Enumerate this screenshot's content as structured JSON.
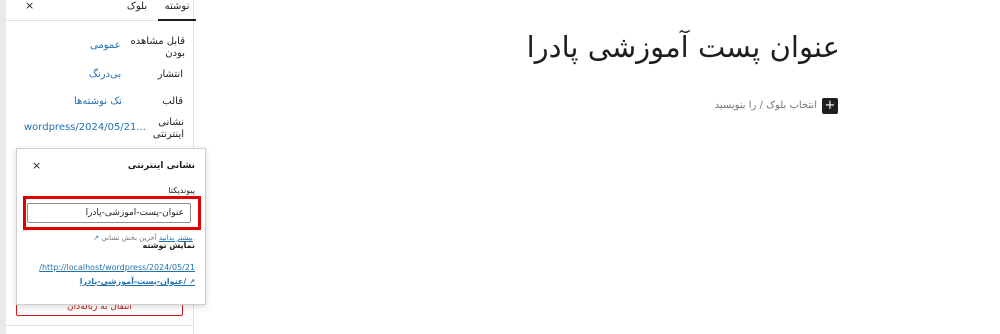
{
  "sidebar": {
    "tabs": [
      {
        "label": "نوشته"
      },
      {
        "label": "بلوک"
      }
    ],
    "close_symbol": "×",
    "rows": [
      {
        "label": "قابل مشاهده بودن",
        "value": "عمومی"
      },
      {
        "label": "انتشار",
        "value": "بی‌درنگ"
      },
      {
        "label": "قالب",
        "value": "تک نوشته‌ها"
      },
      {
        "label": "نشانی اینترنتی",
        "value": "wordpress/2024/05/21..."
      }
    ],
    "trash_label": "انتقال به زباله‌دان"
  },
  "popover": {
    "title": "نشانی اینترنتی",
    "close_symbol": "×",
    "permalink_label": "پیوندیکتا",
    "slug_value": "عنوان-پست-آموزشی-پادرا",
    "help_text": "آخرین بخش نشانی.",
    "help_link": "بیشتر بدانید",
    "view_post_label": "نمایش نوشته",
    "url_line1": "/http://localhost/wordpress/2024/05/21",
    "url_line2": "عنوان-پست-آموزشی-پادرا/"
  },
  "editor": {
    "post_title": "عنوان پست آموزشی پادرا",
    "appender_text": "انتخاب بلوک / را بنویسید",
    "plus_symbol": "+"
  },
  "icons": {
    "close": "close-icon",
    "external": "external-link-icon",
    "plus": "plus-icon"
  }
}
